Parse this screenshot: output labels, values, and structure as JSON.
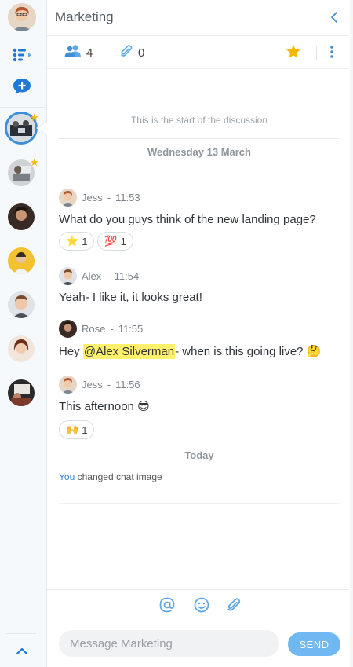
{
  "header": {
    "title": "Marketing"
  },
  "stats": {
    "members": "4",
    "attachments": "0"
  },
  "feed": {
    "start_note": "This is the start of the discussion",
    "day_label": "Wednesday 13 March",
    "messages": [
      {
        "author": "Jess",
        "time": "11:53",
        "text": "What do you guys think of the new landing page?",
        "reactions": [
          {
            "emoji": "⭐",
            "count": "1"
          },
          {
            "emoji": "💯",
            "count": "1"
          }
        ]
      },
      {
        "author": "Alex",
        "time": "11:54",
        "text": "Yeah- I like it, it looks great!"
      },
      {
        "author": "Rose",
        "time": "11:55",
        "text_before": "Hey ",
        "mention": "@Alex Silverman",
        "text_after": "- when is this going live?",
        "emoji": "🤔"
      },
      {
        "author": "Jess",
        "time": "11:56",
        "text": "This afternoon",
        "emoji": "😎",
        "reactions": [
          {
            "emoji": "🙌",
            "count": "1"
          }
        ]
      }
    ],
    "today_label": "Today",
    "system": {
      "actor": "You",
      "action": "changed chat image"
    }
  },
  "composer": {
    "placeholder": "Message Marketing",
    "send_label": "SEND"
  },
  "colors": {
    "accent": "#2f86d6",
    "send_button": "#6fb8f2",
    "star": "#f5b800",
    "mention_highlight": "#fff16b"
  }
}
